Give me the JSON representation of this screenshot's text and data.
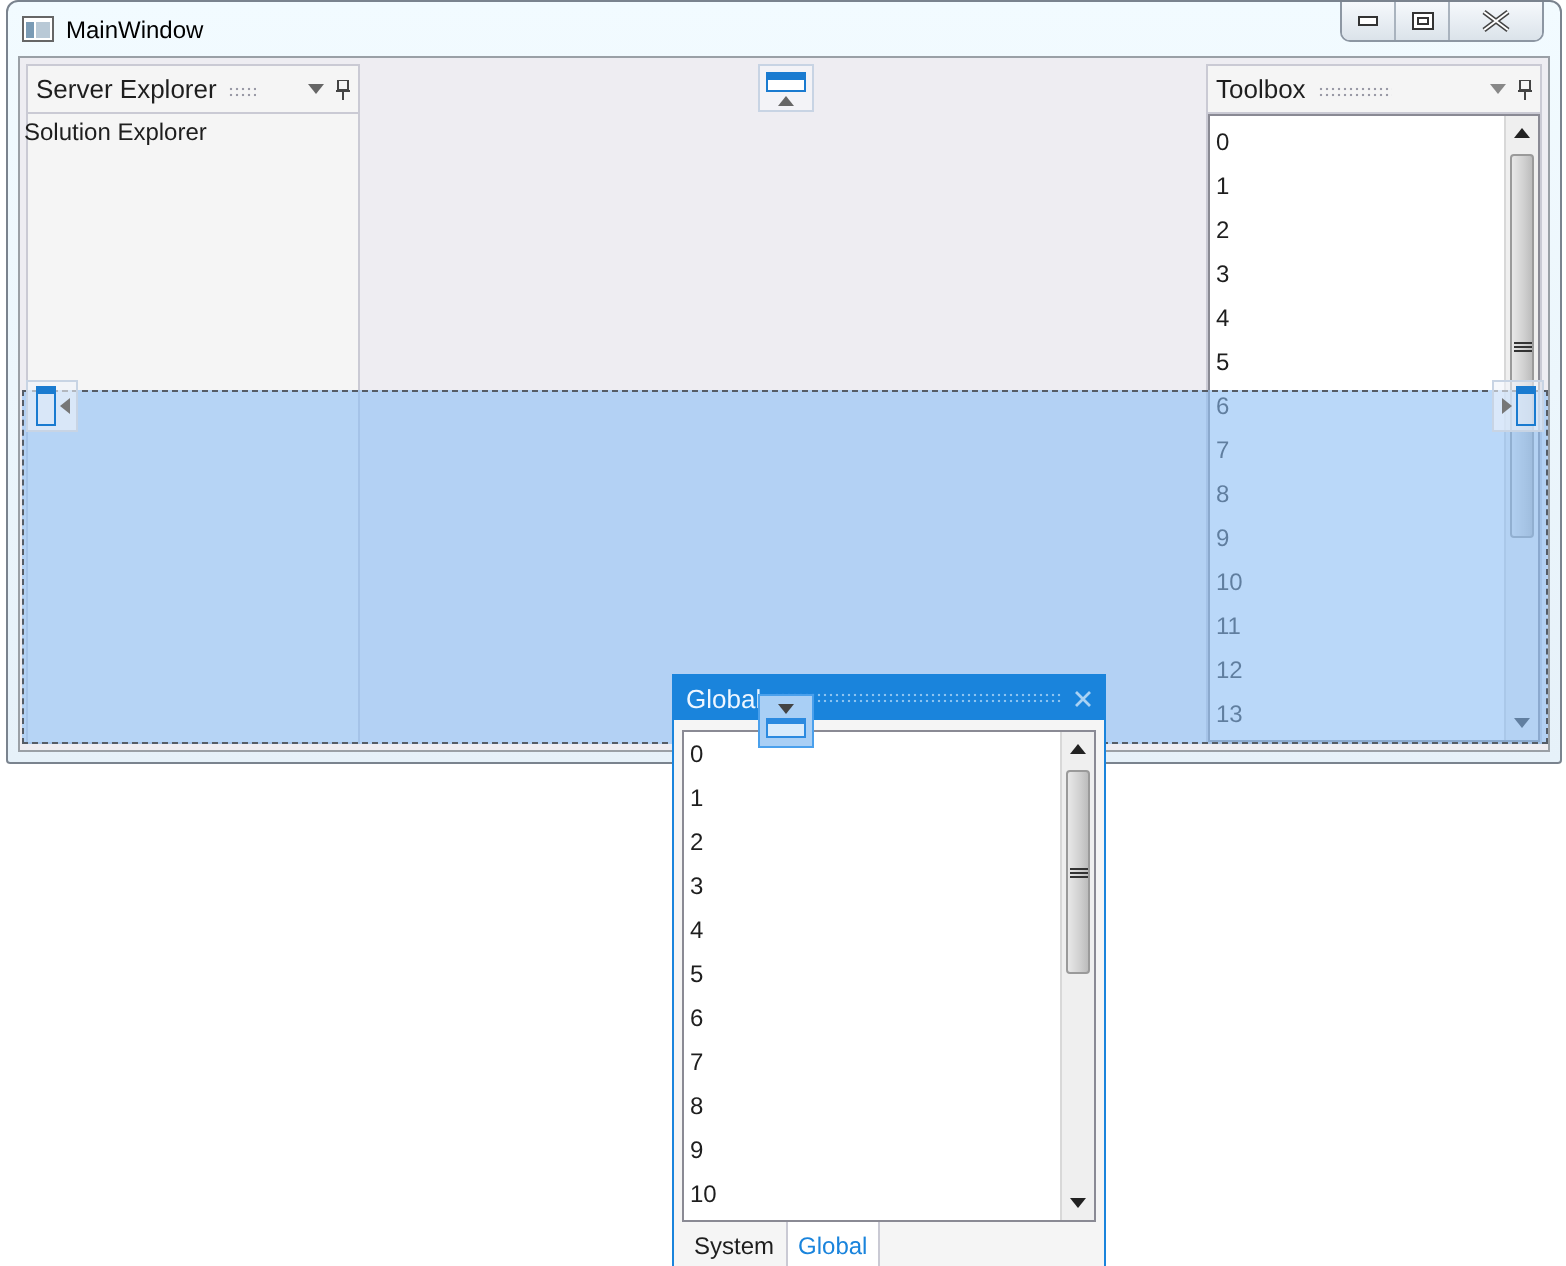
{
  "window": {
    "title": "MainWindow"
  },
  "left_pane": {
    "title": "Server Explorer",
    "content": "Solution Explorer"
  },
  "toolbox": {
    "title": "Toolbox",
    "items": [
      "0",
      "1",
      "2",
      "3",
      "4",
      "5",
      "6",
      "7",
      "8",
      "9",
      "10",
      "11",
      "12",
      "13"
    ]
  },
  "floating_window": {
    "title": "Global",
    "items": [
      "0",
      "1",
      "2",
      "3",
      "4",
      "5",
      "6",
      "7",
      "8",
      "9",
      "10"
    ],
    "tabs": [
      {
        "label": "System",
        "selected": false
      },
      {
        "label": "Global",
        "selected": true
      }
    ]
  }
}
